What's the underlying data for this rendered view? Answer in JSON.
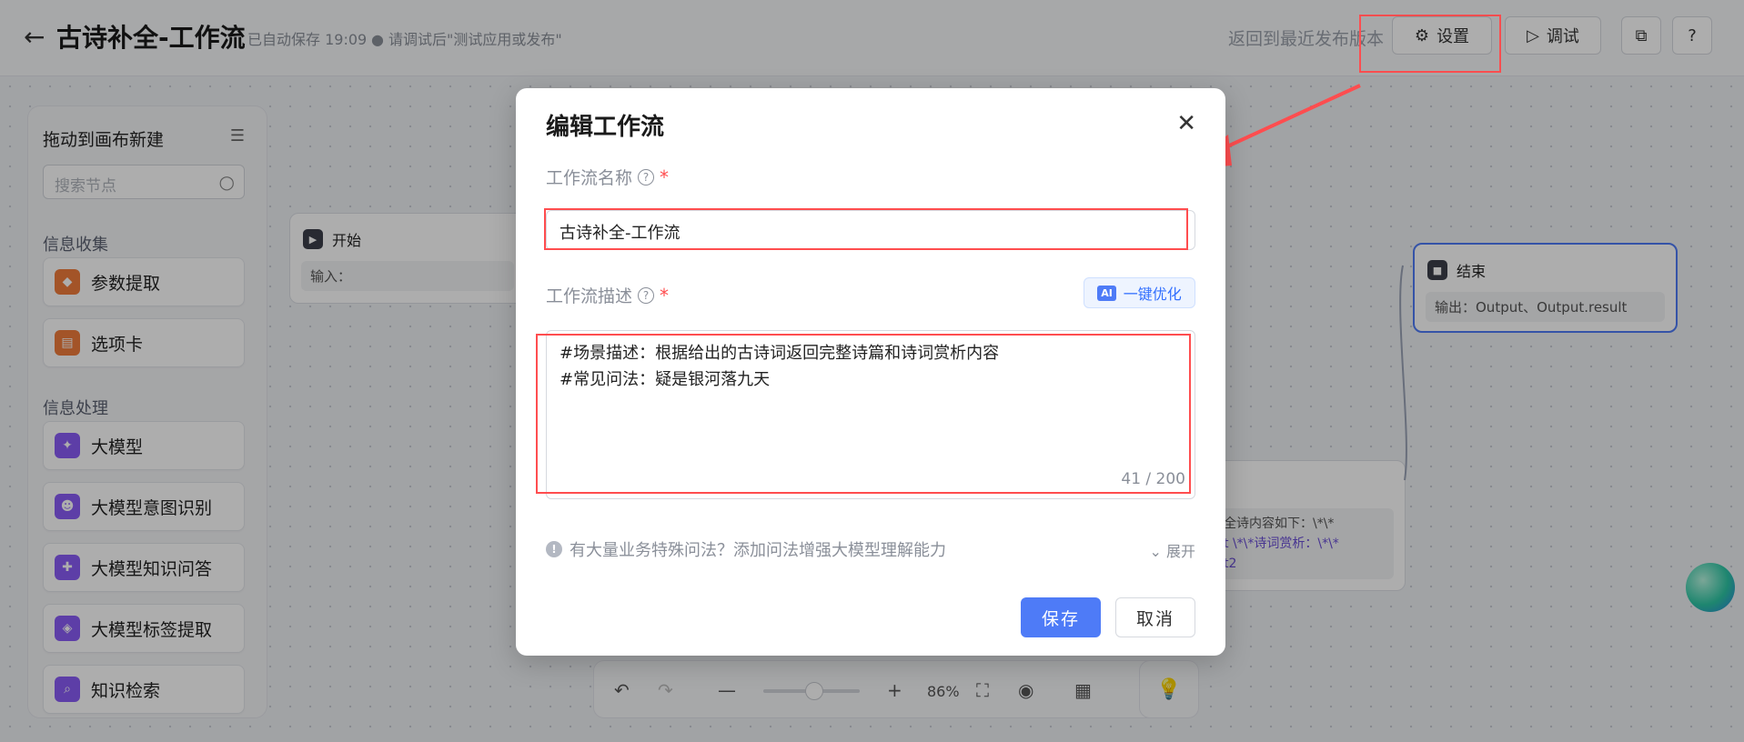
{
  "header": {
    "back_icon": "←",
    "title": "古诗补全-工作流",
    "autosave": "已自动保存 19:09",
    "hint": "请调试后\"测试应用或发布\"",
    "revert_label": "返回到最近发布版本",
    "settings_label": "设置",
    "debug_label": "调试"
  },
  "sidebar": {
    "title": "拖动到画布新建",
    "search_placeholder": "搜索节点",
    "section_collect": "信息收集",
    "section_process": "信息处理",
    "items": [
      {
        "label": "参数提取",
        "color": "#f07c3c"
      },
      {
        "label": "选项卡",
        "color": "#f07c3c"
      },
      {
        "label": "大模型",
        "color": "#8a5cf6"
      },
      {
        "label": "大模型意图识别",
        "color": "#8a5cf6"
      },
      {
        "label": "大模型知识问答",
        "color": "#8a5cf6"
      },
      {
        "label": "大模型标签提取",
        "color": "#8a5cf6"
      },
      {
        "label": "知识检索",
        "color": "#8a5cf6"
      }
    ]
  },
  "canvas": {
    "start_node": {
      "title": "开始",
      "body": "输入："
    },
    "end_node": {
      "title": "结束",
      "body": "输出：Output、Output.result"
    },
    "partial_node": {
      "line1": "全诗内容如下：\\*\\*",
      "line2": "t  \\*\\*诗词赏析：\\*\\*",
      "line3": "t2"
    }
  },
  "modal": {
    "title": "编辑工作流",
    "name_label": "工作流名称",
    "name_value": "古诗补全-工作流",
    "desc_label": "工作流描述",
    "ai_badge": "AI",
    "ai_label": "一键优化",
    "desc_line1": "#场景描述：根据给出的古诗词返回完整诗篇和诗词赏析内容",
    "desc_line2": "#常见问法：疑是银河落九天",
    "desc_count": "41 / 200",
    "tip_text": "有大量业务特殊问法？添加问法增强大模型理解能力",
    "expand_label": "展开",
    "save_label": "保存",
    "cancel_label": "取消"
  },
  "toolbar": {
    "zoom": "86%"
  },
  "colors": {
    "primary": "#4e7bf7",
    "annotation_red": "#ff4d4f"
  }
}
